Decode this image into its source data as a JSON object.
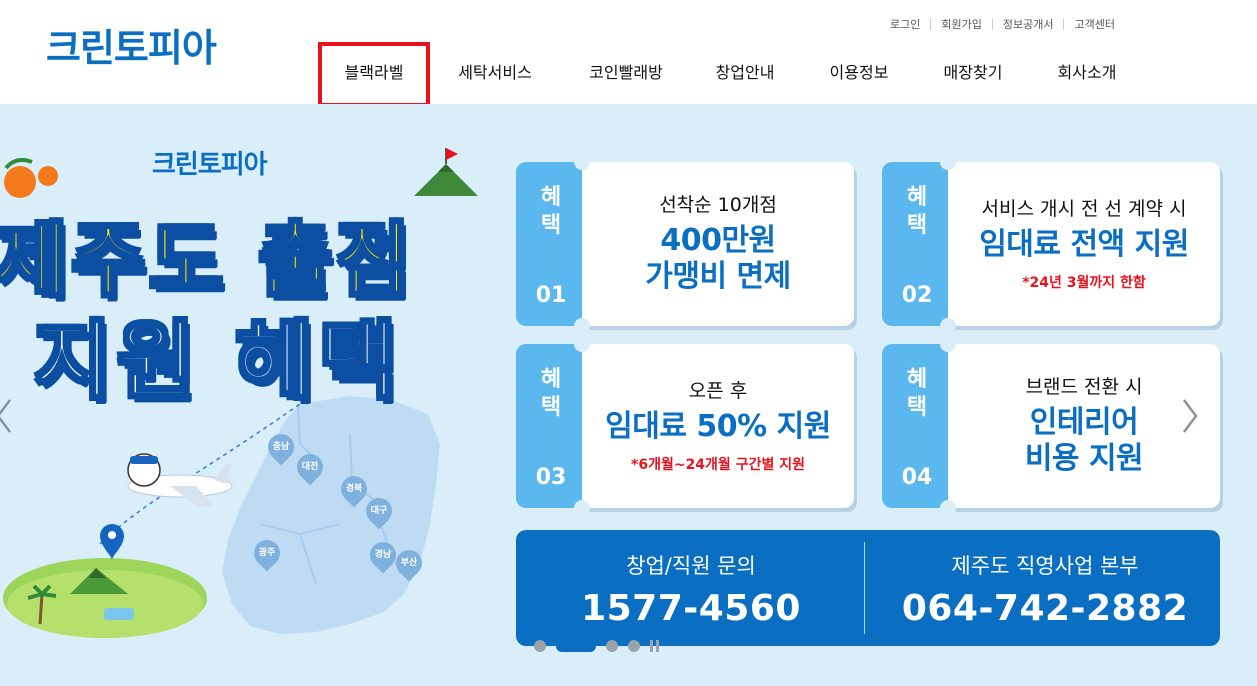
{
  "header": {
    "logo": "크린토피아",
    "util_links": [
      "로그인",
      "회원가입",
      "정보공개서",
      "고객센터"
    ],
    "nav": [
      "블랙라벨",
      "세탁서비스",
      "코인빨래방",
      "창업안내",
      "이용정보",
      "매장찾기",
      "회사소개"
    ],
    "highlighted_nav": "블랙라벨"
  },
  "banner": {
    "logo": "크린토피아",
    "headline_1": "제주도 출점",
    "headline_2": "지원 혜택",
    "map_regions": [
      "충남",
      "대전",
      "경북",
      "대구",
      "광주",
      "경남",
      "부산"
    ],
    "cards": [
      {
        "tab": "혜택",
        "num": "01",
        "line1": "선착순 10개점",
        "line2": "400만원",
        "line3": "가맹비 면제",
        "note": ""
      },
      {
        "tab": "혜택",
        "num": "02",
        "line1": "서비스 개시 전 선 계약 시",
        "line2": "임대료 전액 지원",
        "line3": "",
        "note": "*24년 3월까지 한함"
      },
      {
        "tab": "혜택",
        "num": "03",
        "line1": "오픈 후",
        "line2": "임대료 50% 지원",
        "line3": "",
        "note": "*6개월~24개월 구간별 지원"
      },
      {
        "tab": "혜택",
        "num": "04",
        "line1": "브랜드 전환 시",
        "line2": "인테리어",
        "line3": "비용 지원",
        "note": ""
      }
    ],
    "contact": [
      {
        "label": "창업/직원 문의",
        "tel": "1577-4560"
      },
      {
        "label": "제주도 직영사업 본부",
        "tel": "064-742-2882"
      }
    ],
    "slide_count": 4,
    "active_slide": 2
  },
  "colors": {
    "brand": "#0a6fc2",
    "tab": "#5ab8ef",
    "banner_bg": "#daeefa",
    "highlight": "#e8121d",
    "headline_yellow": "#ffe600"
  }
}
